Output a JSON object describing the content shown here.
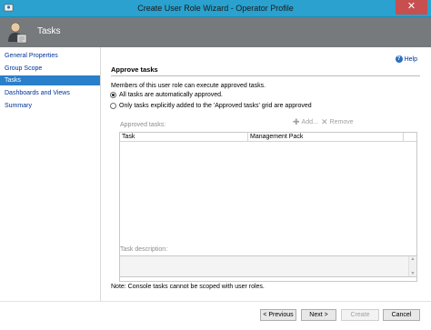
{
  "window": {
    "title": "Create User Role Wizard - Operator Profile",
    "close_glyph": "✕",
    "title_color": "#2aa1ce",
    "close_color": "#c74f4f"
  },
  "header": {
    "title": "Tasks",
    "icon": "user-role-icon",
    "bg_color": "#777a7d"
  },
  "sidebar": {
    "items": [
      {
        "label": "General Properties",
        "active": false
      },
      {
        "label": "Group Scope",
        "active": false
      },
      {
        "label": "Tasks",
        "active": true
      },
      {
        "label": "Dashboards and Views",
        "active": false
      },
      {
        "label": "Summary",
        "active": false
      }
    ],
    "active_color": "#2a7fcb"
  },
  "main": {
    "help_label": "Help",
    "help_glyph": "?",
    "section_title": "Approve tasks",
    "description": "Members of this user role can execute approved tasks.",
    "options": [
      {
        "label": "All tasks are automatically approved.",
        "checked": true
      },
      {
        "label": "Only tasks explicitly added to the 'Approved tasks' grid are approved",
        "checked": false
      }
    ],
    "approved_tasks_label": "Approved tasks:",
    "add_label": "Add...",
    "remove_label": "Remove",
    "grid_columns": [
      "Task",
      "Management Pack"
    ],
    "task_description_label": "Task description:",
    "note": "Note: Console tasks cannot be scoped with user roles."
  },
  "footer": {
    "previous_label": "< Previous",
    "next_label": "Next >",
    "create_label": "Create",
    "cancel_label": "Cancel",
    "create_disabled": true
  }
}
